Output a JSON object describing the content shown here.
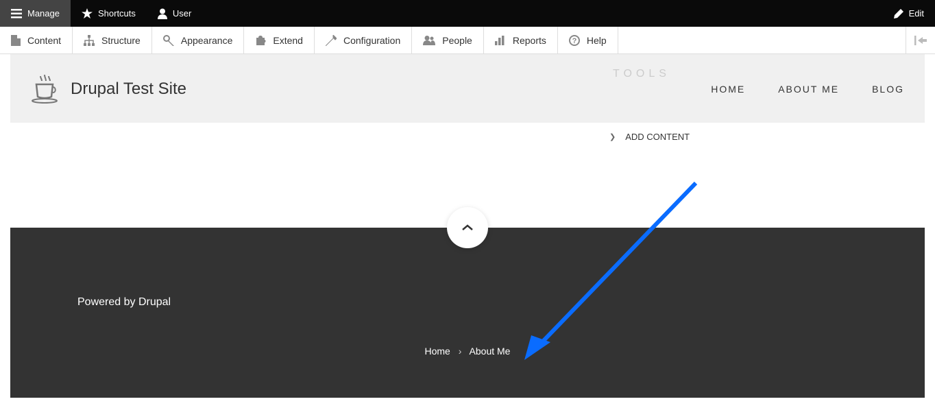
{
  "topToolbar": {
    "manage": "Manage",
    "shortcuts": "Shortcuts",
    "user": "User",
    "edit": "Edit"
  },
  "adminMenu": {
    "items": [
      {
        "label": "Content"
      },
      {
        "label": "Structure"
      },
      {
        "label": "Appearance"
      },
      {
        "label": "Extend"
      },
      {
        "label": "Configuration"
      },
      {
        "label": "People"
      },
      {
        "label": "Reports"
      },
      {
        "label": "Help"
      }
    ]
  },
  "siteHeader": {
    "title": "Drupal Test Site",
    "nav": [
      {
        "label": "HOME"
      },
      {
        "label": "ABOUT ME"
      },
      {
        "label": "BLOG"
      }
    ]
  },
  "tools": {
    "heading": "TOOLS",
    "addContent": "ADD CONTENT"
  },
  "footer": {
    "poweredBy": "Powered by Drupal",
    "breadcrumb": {
      "home": "Home",
      "current": "About Me"
    }
  }
}
